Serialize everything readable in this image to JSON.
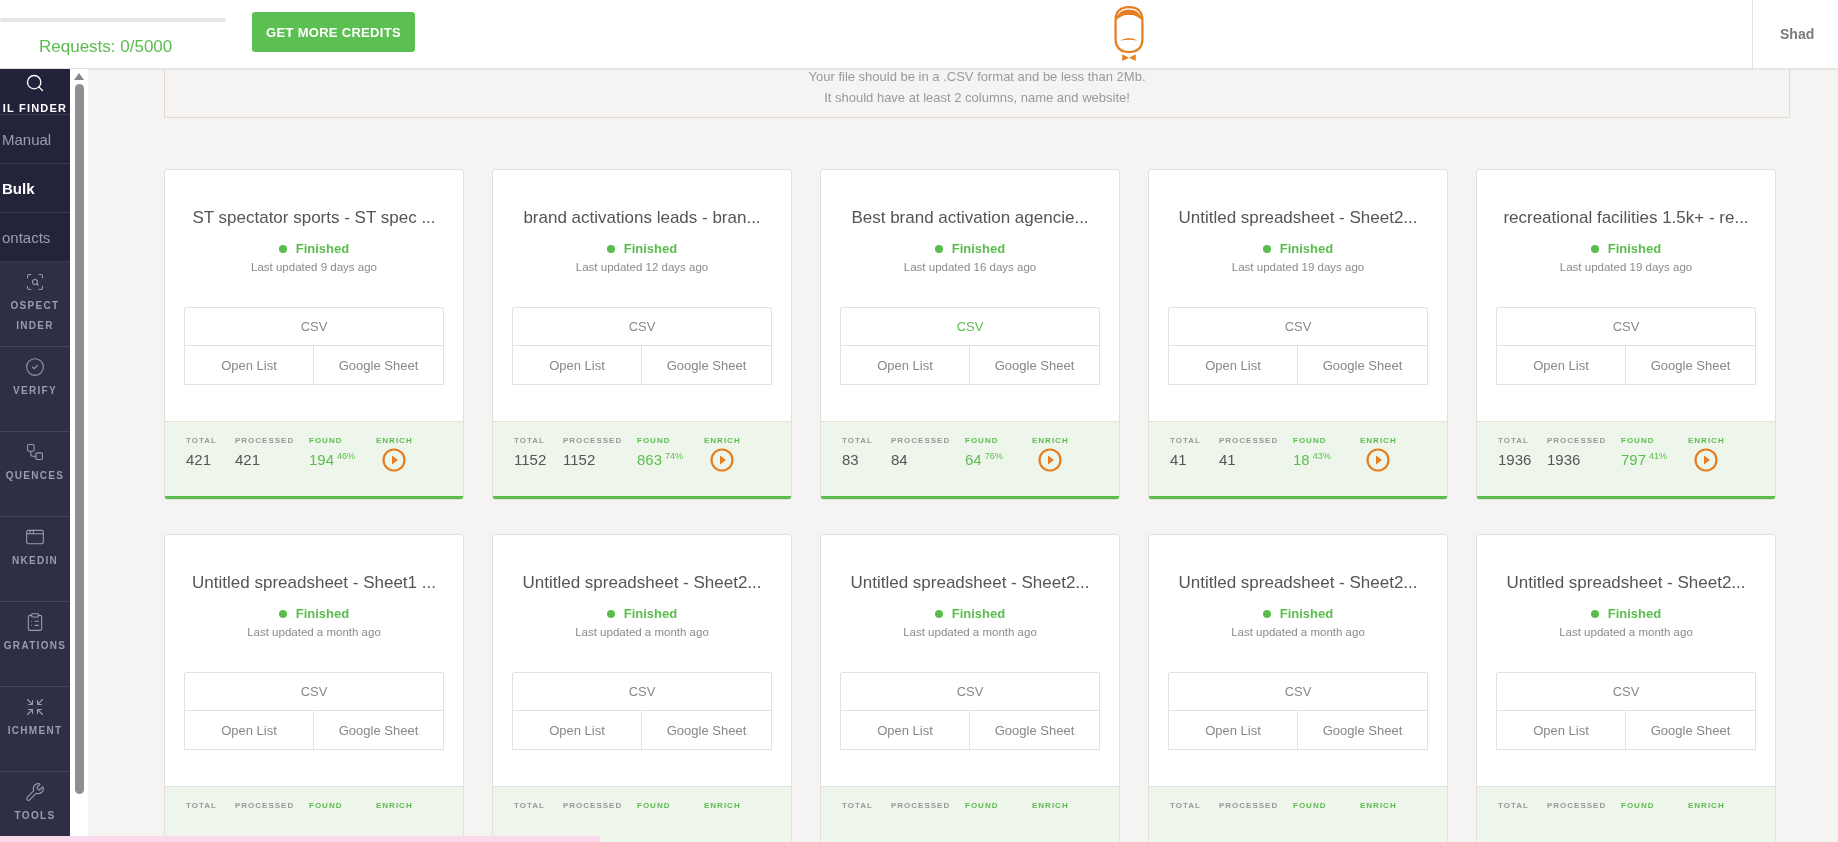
{
  "header": {
    "requests": "Requests: 0/5000",
    "credits_button": "GET MORE CREDITS",
    "user": "Shad"
  },
  "sidebar": {
    "items": [
      {
        "kind": "top",
        "label": "IL FINDER"
      },
      {
        "kind": "sub",
        "label": "Manual",
        "selected": false
      },
      {
        "kind": "sub",
        "label": "Bulk",
        "selected": true
      },
      {
        "kind": "sub",
        "label": "ontacts",
        "selected": false
      },
      {
        "kind": "tool",
        "label": "OSPECT",
        "label2": "INDER"
      },
      {
        "kind": "tool",
        "label": "VERIFY"
      },
      {
        "kind": "tool",
        "label": "QUENCES"
      },
      {
        "kind": "tool",
        "label": "NKEDIN"
      },
      {
        "kind": "tool",
        "label": "GRATIONS"
      },
      {
        "kind": "tool",
        "label": "ICHMENT"
      },
      {
        "kind": "tool",
        "label": "TOOLS"
      }
    ]
  },
  "upload": {
    "lines": [
      "Your file should be in a .CSV format and be less than 2Mb.",
      "It should have at least 2 columns, name and website!"
    ]
  },
  "cards": [
    {
      "title": "ST spectator sports - ST spec ...",
      "status": "Finished",
      "updated": "Last updated 9 days ago",
      "csv": "CSV",
      "csv_active": false,
      "open": "Open List",
      "sheet": "Google Sheet",
      "labels": {
        "total": "TOTAL",
        "processed": "PROCESSED",
        "found": "FOUND",
        "enrich": "ENRICH"
      },
      "total": "421",
      "processed": "421",
      "found": "194",
      "percent": "46%"
    },
    {
      "title": "brand activations leads - bran...",
      "status": "Finished",
      "updated": "Last updated 12 days ago",
      "csv": "CSV",
      "csv_active": false,
      "open": "Open List",
      "sheet": "Google Sheet",
      "labels": {
        "total": "TOTAL",
        "processed": "PROCESSED",
        "found": "FOUND",
        "enrich": "ENRICH"
      },
      "total": "1152",
      "processed": "1152",
      "found": "863",
      "percent": "74%"
    },
    {
      "title": "Best brand activation agencie...",
      "status": "Finished",
      "updated": "Last updated 16 days ago",
      "csv": "CSV",
      "csv_active": true,
      "open": "Open List",
      "sheet": "Google Sheet",
      "labels": {
        "total": "TOTAL",
        "processed": "PROCESSED",
        "found": "FOUND",
        "enrich": "ENRICH"
      },
      "total": "83",
      "processed": "84",
      "found": "64",
      "percent": "76%"
    },
    {
      "title": "Untitled spreadsheet - Sheet2...",
      "status": "Finished",
      "updated": "Last updated 19 days ago",
      "csv": "CSV",
      "csv_active": false,
      "open": "Open List",
      "sheet": "Google Sheet",
      "labels": {
        "total": "TOTAL",
        "processed": "PROCESSED",
        "found": "FOUND",
        "enrich": "ENRICH"
      },
      "total": "41",
      "processed": "41",
      "found": "18",
      "percent": "43%"
    },
    {
      "title": "recreational facilities 1.5k+ - re...",
      "status": "Finished",
      "updated": "Last updated 19 days ago",
      "csv": "CSV",
      "csv_active": false,
      "open": "Open List",
      "sheet": "Google Sheet",
      "labels": {
        "total": "TOTAL",
        "processed": "PROCESSED",
        "found": "FOUND",
        "enrich": "ENRICH"
      },
      "total": "1936",
      "processed": "1936",
      "found": "797",
      "percent": "41%"
    },
    {
      "title": "Untitled spreadsheet - Sheet1 ...",
      "status": "Finished",
      "updated": "Last updated a month ago",
      "csv": "CSV",
      "csv_active": false,
      "open": "Open List",
      "sheet": "Google Sheet",
      "labels": {
        "total": "TOTAL",
        "processed": "PROCESSED",
        "found": "FOUND",
        "enrich": "ENRICH"
      }
    },
    {
      "title": "Untitled spreadsheet - Sheet2...",
      "status": "Finished",
      "updated": "Last updated a month ago",
      "csv": "CSV",
      "csv_active": false,
      "open": "Open List",
      "sheet": "Google Sheet",
      "labels": {
        "total": "TOTAL",
        "processed": "PROCESSED",
        "found": "FOUND",
        "enrich": "ENRICH"
      }
    },
    {
      "title": "Untitled spreadsheet - Sheet2...",
      "status": "Finished",
      "updated": "Last updated a month ago",
      "csv": "CSV",
      "csv_active": false,
      "open": "Open List",
      "sheet": "Google Sheet",
      "labels": {
        "total": "TOTAL",
        "processed": "PROCESSED",
        "found": "FOUND",
        "enrich": "ENRICH"
      }
    },
    {
      "title": "Untitled spreadsheet - Sheet2...",
      "status": "Finished",
      "updated": "Last updated a month ago",
      "csv": "CSV",
      "csv_active": false,
      "open": "Open List",
      "sheet": "Google Sheet",
      "labels": {
        "total": "TOTAL",
        "processed": "PROCESSED",
        "found": "FOUND",
        "enrich": "ENRICH"
      }
    },
    {
      "title": "Untitled spreadsheet - Sheet2...",
      "status": "Finished",
      "updated": "Last updated a month ago",
      "csv": "CSV",
      "csv_active": false,
      "open": "Open List",
      "sheet": "Google Sheet",
      "labels": {
        "total": "TOTAL",
        "processed": "PROCESSED",
        "found": "FOUND",
        "enrich": "ENRICH"
      }
    }
  ]
}
